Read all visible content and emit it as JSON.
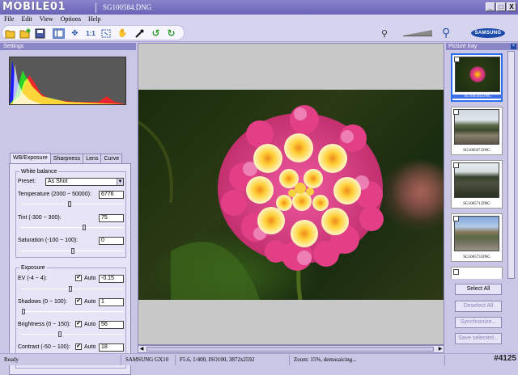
{
  "app": {
    "logo_text": "MOBILE01",
    "title": "SG100584.DNG",
    "window_buttons": {
      "minimize": "_",
      "maximize": "□",
      "close": "X"
    }
  },
  "menu": [
    "File",
    "Edit",
    "View",
    "Options",
    "Help"
  ],
  "toolbar": {
    "icons": [
      "open-folder-icon",
      "open-recent-icon",
      "save-icon",
      "layout-icon",
      "move-icon",
      "actual-size-icon",
      "fit-icon",
      "hand-icon",
      "eyedropper-icon",
      "rotate-left-icon",
      "rotate-right-icon"
    ],
    "actual_size_label": "1:1",
    "brand_label": "SAMSUNG"
  },
  "settings": {
    "header": "Settings",
    "tabs": [
      "WB/Exposure",
      "Sharpness",
      "Lens",
      "Curve"
    ],
    "active_tab": "WB/Exposure",
    "white_balance": {
      "title": "White balance",
      "preset_label": "Preset:",
      "preset_value": "As Shot",
      "temperature_label": "Temperature (2000 ~ 50000):",
      "temperature_value": "6776",
      "temperature_slider": 0.47,
      "tint_label": "Tint (-300 ~ 300):",
      "tint_value": "75",
      "tint_slider": 0.62,
      "saturation_label": "Saturation (-100 ~ 100):",
      "saturation_value": "0",
      "saturation_slider": 0.5
    },
    "exposure": {
      "title": "Exposure",
      "ev_label": "EV (-4 ~ 4):",
      "ev_auto_label": "Auto",
      "ev_auto": true,
      "ev_value": "-0.15",
      "ev_slider": 0.48,
      "shadows_label": "Shadows (0 ~ 100):",
      "shadows_auto_label": "Auto",
      "shadows_auto": true,
      "shadows_value": "1",
      "shadows_slider": 0.01,
      "brightness_label": "Brightness (0 ~ 150):",
      "brightness_auto_label": "Auto",
      "brightness_auto": true,
      "brightness_value": "56",
      "brightness_slider": 0.37,
      "contrast_label": "Contrast (-50 ~ 100):",
      "contrast_auto_label": "Auto",
      "contrast_auto": true,
      "contrast_value": "18",
      "contrast_slider": 0.45
    }
  },
  "tray": {
    "header": "Picture tray",
    "thumbnails": [
      {
        "label": "SG100584.DNG",
        "selected": true
      },
      {
        "label": "SG100567.DNG",
        "selected": false
      },
      {
        "label": "SG100571.DNG",
        "selected": false
      },
      {
        "label": "SG100573.DNG",
        "selected": false
      }
    ],
    "buttons": {
      "select_all": "Select All",
      "deselect_all": "Deselect All",
      "synchronize": "Synchronize...",
      "save_selected": "Save selected..."
    }
  },
  "status": {
    "ready": "Ready",
    "camera": "SAMSUNG GX10",
    "exposure_info": "F5.6, 1/400, ISO100, 3872x2592",
    "zoom": "Zoom: 15%, demosaicing..."
  },
  "watermark": "#4125"
}
